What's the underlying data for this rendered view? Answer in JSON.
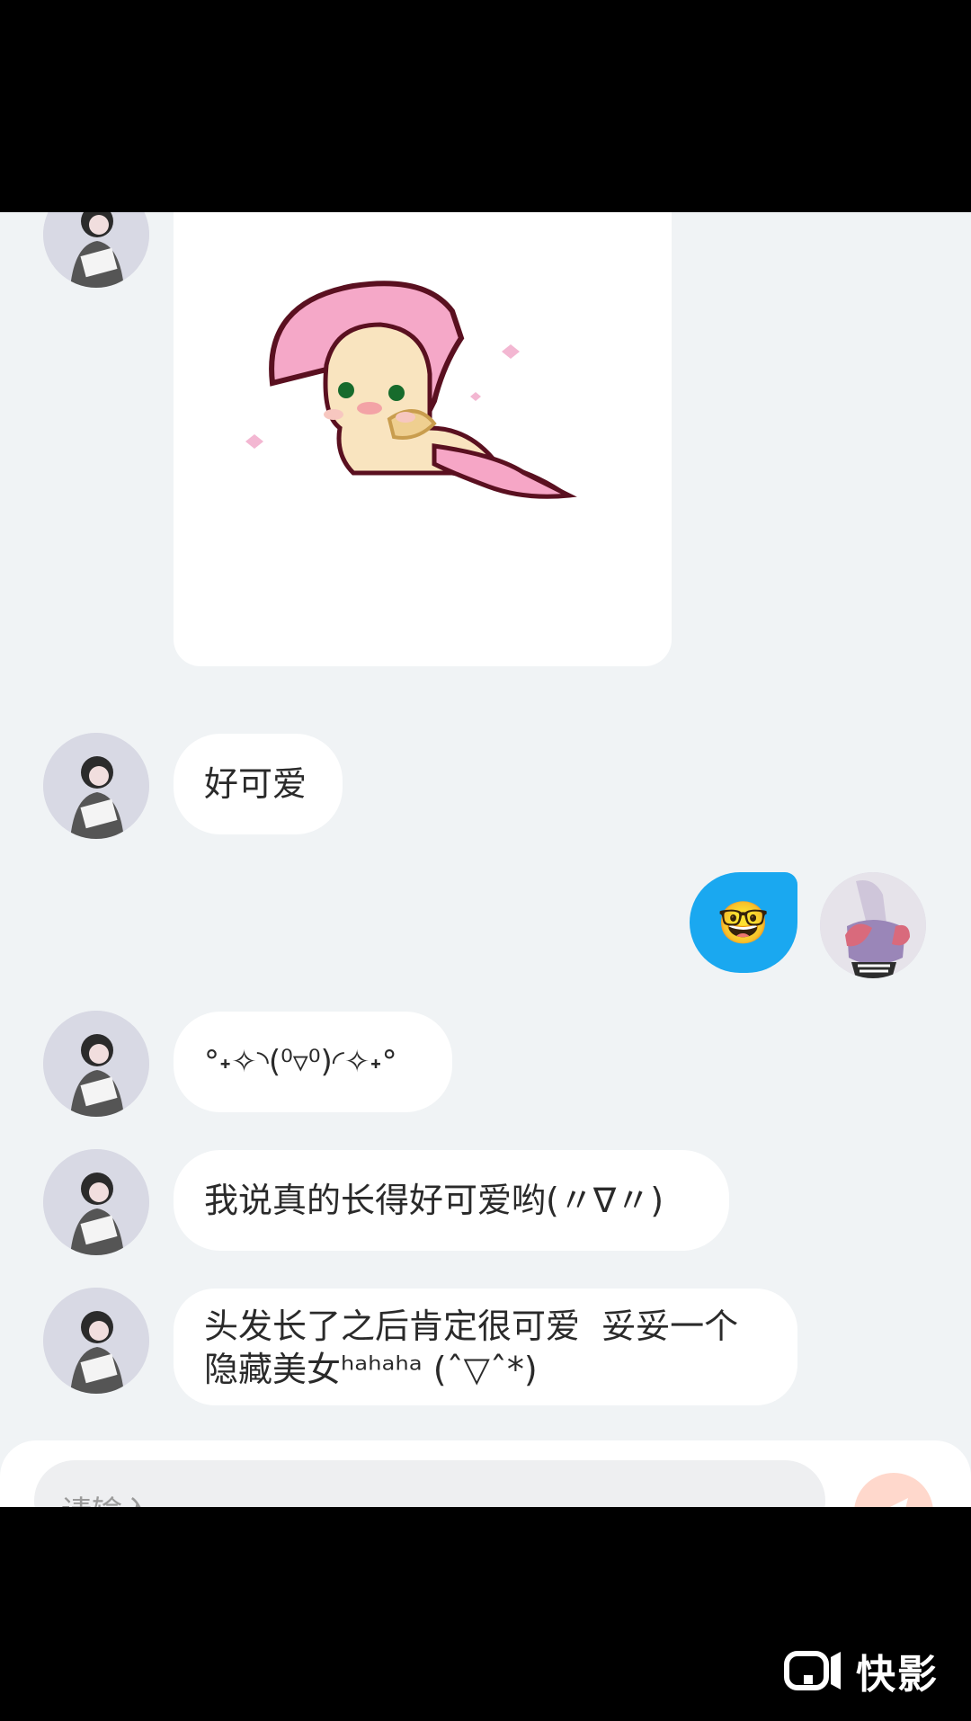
{
  "messages": [
    {
      "from": "other",
      "type": "sticker",
      "sticker": "pink-pony-sticker"
    },
    {
      "from": "other",
      "type": "text",
      "text": "好可爱"
    },
    {
      "from": "me",
      "type": "emoji",
      "emoji": "🤓"
    },
    {
      "from": "other",
      "type": "text",
      "text": "°˖✧◝(⁰▿⁰)◜✧˖°"
    },
    {
      "from": "other",
      "type": "text",
      "text": "我说真的长得好可爱哟(〃∇〃)"
    },
    {
      "from": "other",
      "type": "text",
      "text": "头发长了之后肯定很可爱  妥妥一个\n隐藏美女ʰᵃʰᵃʰᵃ (ˆ▽ˆ*)"
    }
  ],
  "composer": {
    "placeholder": "请输入"
  },
  "watermark": {
    "brand": "快影"
  },
  "colors": {
    "outgoing_bubble": "#1aa8f0",
    "incoming_bubble": "#ffffff",
    "chat_background": "#f0f3f5"
  }
}
